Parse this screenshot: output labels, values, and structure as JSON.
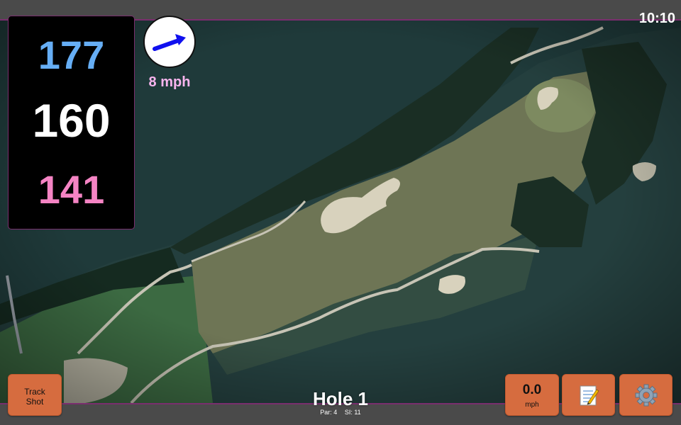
{
  "status": {
    "time": "10:10"
  },
  "distances": {
    "back": "177",
    "middle": "160",
    "front": "141"
  },
  "wind": {
    "speed": "8 mph",
    "icon": "arrow-icon",
    "direction": "east-northeast"
  },
  "hole": {
    "title": "Hole 1",
    "par": "Par: 4",
    "si": "SI: 11"
  },
  "buttons": {
    "track_shot": "Track\nShot",
    "speed_value": "0.0",
    "speed_unit": "mph",
    "notes_icon": "memo-icon",
    "settings_icon": "gear-icon"
  },
  "colors": {
    "accent_border": "#7a2e6e",
    "button_bg": "#d66c3f",
    "back_distance": "#66aef5",
    "middle_distance": "#ffffff",
    "front_distance": "#f584c4",
    "wind_text": "#f8b4ee",
    "wind_arrow": "#1010ee"
  }
}
